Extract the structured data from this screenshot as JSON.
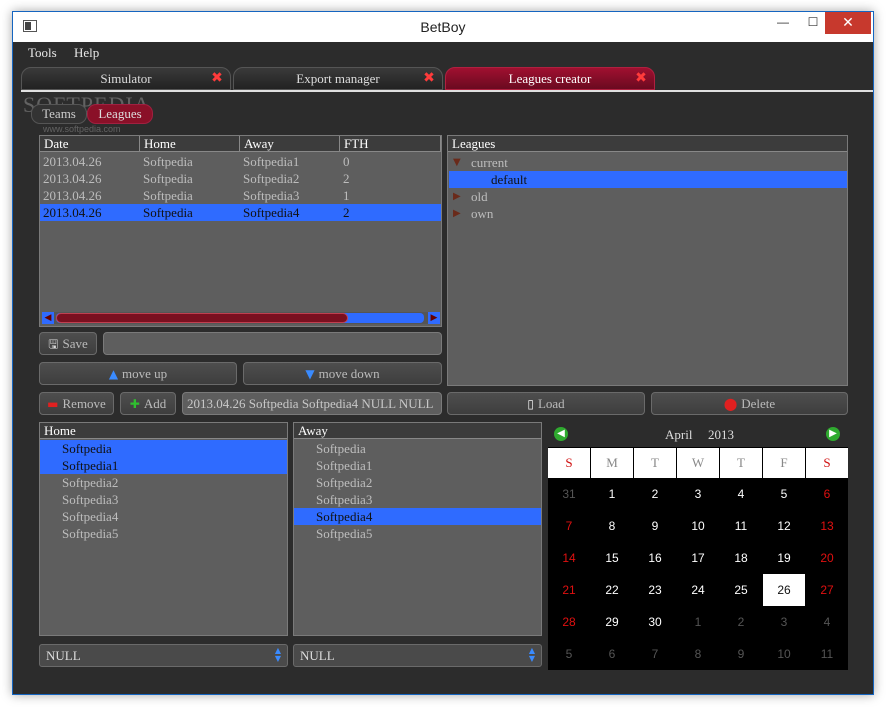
{
  "window": {
    "title": "BetBoy",
    "min": "—",
    "max": "☐",
    "close": "✕"
  },
  "menu": [
    "Tools",
    "Help"
  ],
  "main_tabs": [
    {
      "label": "Simulator",
      "close": "✖"
    },
    {
      "label": "Export manager",
      "close": "✖"
    },
    {
      "label": "Leagues creator",
      "close": "✖",
      "active": true
    }
  ],
  "sub_tabs": [
    "Teams",
    "Leagues"
  ],
  "watermark": {
    "text": "SOFTPEDIA",
    "url": "www.softpedia.com"
  },
  "matches": {
    "columns": [
      "Date",
      "Home",
      "Away",
      "FTH"
    ],
    "rows": [
      [
        "2013.04.26",
        "Softpedia",
        "Softpedia1",
        "0"
      ],
      [
        "2013.04.26",
        "Softpedia",
        "Softpedia2",
        "2"
      ],
      [
        "2013.04.26",
        "Softpedia",
        "Softpedia3",
        "1"
      ],
      [
        "2013.04.26",
        "Softpedia",
        "Softpedia4",
        "2"
      ]
    ],
    "selected_row": 3
  },
  "leagues": {
    "header": "Leagues",
    "items": [
      {
        "label": "current",
        "expanded": true
      },
      {
        "label": "default",
        "child": true,
        "selected": true
      },
      {
        "label": "old",
        "expanded": false
      },
      {
        "label": "own",
        "expanded": false
      }
    ]
  },
  "buttons": {
    "save": "Save",
    "move_up": "move up",
    "move_down": "move down",
    "remove": "Remove",
    "add": "Add",
    "load": "Load",
    "delete": "Delete"
  },
  "save_field": "",
  "match_summary": "2013.04.26 Softpedia Softpedia4 NULL NULL",
  "home_list": {
    "header": "Home",
    "items": [
      "Softpedia",
      "Softpedia1",
      "Softpedia2",
      "Softpedia3",
      "Softpedia4",
      "Softpedia5"
    ],
    "selected": [
      0,
      1
    ]
  },
  "away_list": {
    "header": "Away",
    "items": [
      "Softpedia",
      "Softpedia1",
      "Softpedia2",
      "Softpedia3",
      "Softpedia4",
      "Softpedia5"
    ],
    "selected": [
      4
    ]
  },
  "home_combo": "NULL",
  "away_combo": "NULL",
  "calendar": {
    "month": "April",
    "year": "2013",
    "prev": "◀",
    "next": "▶",
    "dow": [
      "S",
      "M",
      "T",
      "W",
      "T",
      "F",
      "S"
    ],
    "weeks": [
      [
        "31",
        "1",
        "2",
        "3",
        "4",
        "5",
        "6"
      ],
      [
        "7",
        "8",
        "9",
        "10",
        "11",
        "12",
        "13"
      ],
      [
        "14",
        "15",
        "16",
        "17",
        "18",
        "19",
        "20"
      ],
      [
        "21",
        "22",
        "23",
        "24",
        "25",
        "26",
        "27"
      ],
      [
        "28",
        "29",
        "30",
        "1",
        "2",
        "3",
        "4"
      ],
      [
        "5",
        "6",
        "7",
        "8",
        "9",
        "10",
        "11"
      ]
    ],
    "today": "26"
  },
  "colors": {
    "accent": "#2f6bff",
    "tab_active": "#8a1028",
    "weekend": "#e01010"
  }
}
